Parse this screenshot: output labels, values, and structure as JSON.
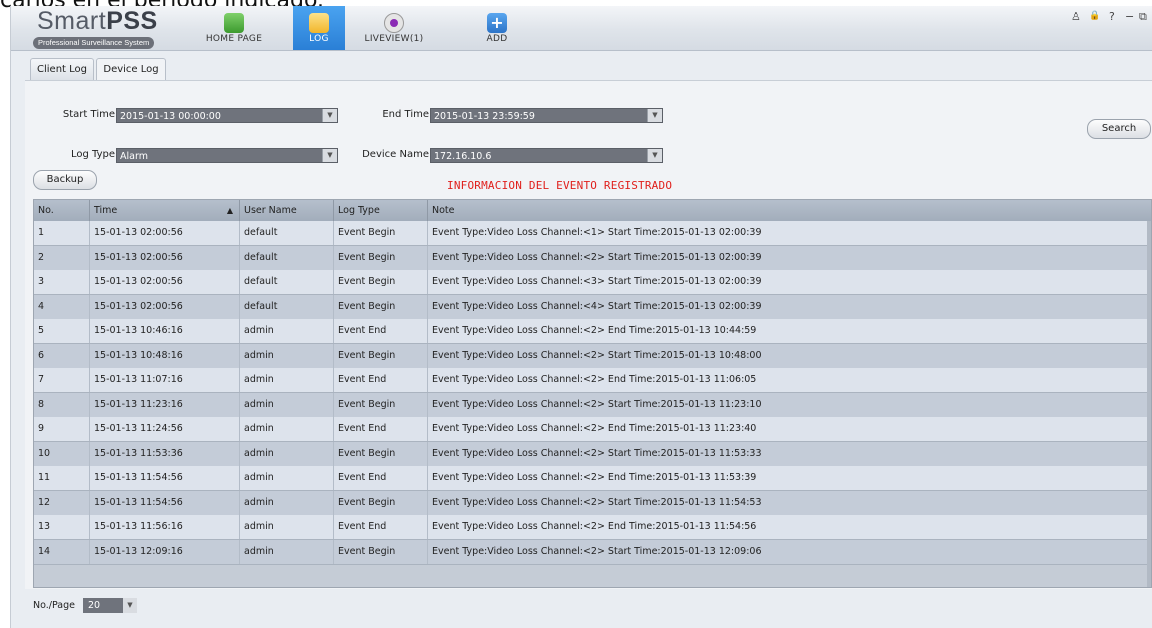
{
  "caption": "carlos en el periodo indicado.",
  "app": {
    "logo_title_a": "Smart",
    "logo_title_b": "PSS",
    "logo_subtitle": "Professional Surveillance System"
  },
  "nav": [
    {
      "label": "HOME PAGE"
    },
    {
      "label": "LOG"
    },
    {
      "label": "LIVEVIEW(1)"
    },
    {
      "label": "ADD"
    }
  ],
  "window_controls": [
    "♙",
    "🔒",
    "?",
    "−",
    "⧉"
  ],
  "tabs": [
    {
      "label": "Client Log"
    },
    {
      "label": "Device Log"
    }
  ],
  "filters": {
    "start_time_label": "Start Time",
    "start_time_value": "2015-01-13 00:00:00",
    "end_time_label": "End Time",
    "end_time_value": "2015-01-13 23:59:59",
    "log_type_label": "Log Type",
    "log_type_value": "Alarm",
    "device_name_label": "Device Name",
    "device_name_value": "172.16.10.6"
  },
  "buttons": {
    "search": "Search",
    "backup": "Backup"
  },
  "annotation": "INFORMACION DEL EVENTO REGISTRADO",
  "table": {
    "headers": [
      "No.",
      "Time",
      "User Name",
      "Log Type",
      "Note"
    ],
    "rows": [
      {
        "no": "1",
        "time": "15-01-13 02:00:56",
        "user": "default",
        "type": "Event Begin",
        "note": "Event Type:Video Loss Channel:<1> Start Time:2015-01-13 02:00:39"
      },
      {
        "no": "2",
        "time": "15-01-13 02:00:56",
        "user": "default",
        "type": "Event Begin",
        "note": "Event Type:Video Loss Channel:<2> Start Time:2015-01-13 02:00:39"
      },
      {
        "no": "3",
        "time": "15-01-13 02:00:56",
        "user": "default",
        "type": "Event Begin",
        "note": "Event Type:Video Loss Channel:<3> Start Time:2015-01-13 02:00:39"
      },
      {
        "no": "4",
        "time": "15-01-13 02:00:56",
        "user": "default",
        "type": "Event Begin",
        "note": "Event Type:Video Loss Channel:<4> Start Time:2015-01-13 02:00:39"
      },
      {
        "no": "5",
        "time": "15-01-13 10:46:16",
        "user": "admin",
        "type": "Event End",
        "note": "Event Type:Video Loss Channel:<2> End Time:2015-01-13 10:44:59"
      },
      {
        "no": "6",
        "time": "15-01-13 10:48:16",
        "user": "admin",
        "type": "Event Begin",
        "note": "Event Type:Video Loss Channel:<2> Start Time:2015-01-13 10:48:00"
      },
      {
        "no": "7",
        "time": "15-01-13 11:07:16",
        "user": "admin",
        "type": "Event End",
        "note": "Event Type:Video Loss Channel:<2> End Time:2015-01-13 11:06:05"
      },
      {
        "no": "8",
        "time": "15-01-13 11:23:16",
        "user": "admin",
        "type": "Event Begin",
        "note": "Event Type:Video Loss Channel:<2> Start Time:2015-01-13 11:23:10"
      },
      {
        "no": "9",
        "time": "15-01-13 11:24:56",
        "user": "admin",
        "type": "Event End",
        "note": "Event Type:Video Loss Channel:<2> End Time:2015-01-13 11:23:40"
      },
      {
        "no": "10",
        "time": "15-01-13 11:53:36",
        "user": "admin",
        "type": "Event Begin",
        "note": "Event Type:Video Loss Channel:<2> Start Time:2015-01-13 11:53:33"
      },
      {
        "no": "11",
        "time": "15-01-13 11:54:56",
        "user": "admin",
        "type": "Event End",
        "note": "Event Type:Video Loss Channel:<2> End Time:2015-01-13 11:53:39"
      },
      {
        "no": "12",
        "time": "15-01-13 11:54:56",
        "user": "admin",
        "type": "Event Begin",
        "note": "Event Type:Video Loss Channel:<2> Start Time:2015-01-13 11:54:53"
      },
      {
        "no": "13",
        "time": "15-01-13 11:56:16",
        "user": "admin",
        "type": "Event End",
        "note": "Event Type:Video Loss Channel:<2> End Time:2015-01-13 11:54:56"
      },
      {
        "no": "14",
        "time": "15-01-13 12:09:16",
        "user": "admin",
        "type": "Event Begin",
        "note": "Event Type:Video Loss Channel:<2> Start Time:2015-01-13 12:09:06"
      }
    ]
  },
  "pager": {
    "label": "No./Page",
    "value": "20"
  },
  "icons": {
    "home": "home-icon",
    "log": "log-icon",
    "liveview": "camera-icon",
    "add": "plus-icon",
    "dropdown": "chevron-down-icon",
    "sort": "sort-asc-icon"
  },
  "colors": {
    "annotation": "#e0201c",
    "active_nav": "#2a7fd6",
    "field_bg": "#6f737c"
  }
}
